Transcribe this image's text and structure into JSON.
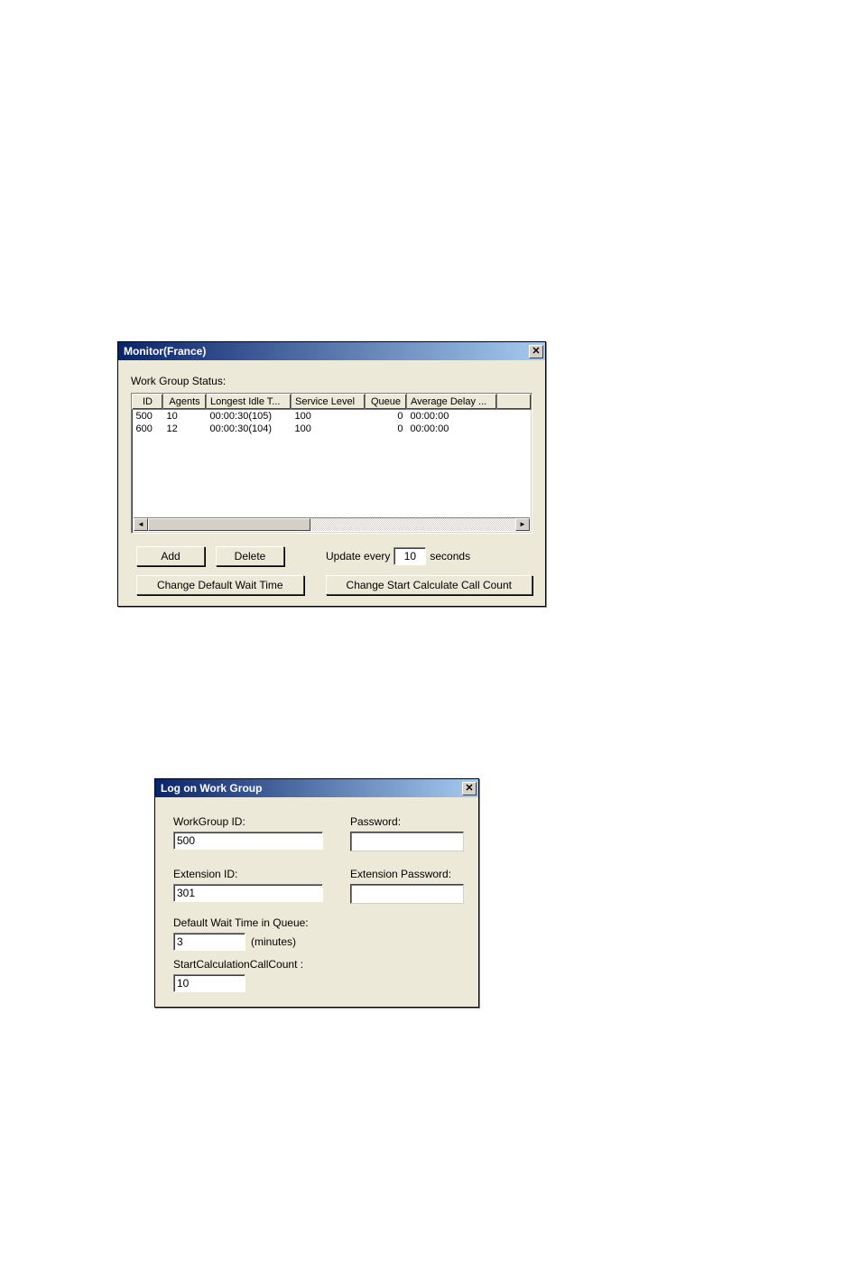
{
  "monitor": {
    "title": "Monitor(France)",
    "status_label": "Work Group Status:",
    "columns": [
      "ID",
      "Agents",
      "Longest Idle T...",
      "Service Level",
      "Queue",
      "Average Delay ..."
    ],
    "rows": [
      {
        "id": "500",
        "agents": "10",
        "lit": "00:00:30(105)",
        "sl": "100",
        "queue": "0",
        "ad": "00:00:00"
      },
      {
        "id": "600",
        "agents": "12",
        "lit": "00:00:30(104)",
        "sl": "100",
        "queue": "0",
        "ad": "00:00:00"
      }
    ],
    "buttons": {
      "add": "Add",
      "delete": "Delete",
      "change_wait": "Change Default Wait Time",
      "change_count": "Change Start Calculate Call Count"
    },
    "update_prefix": "Update every",
    "update_value": "10",
    "update_suffix": "seconds"
  },
  "logon": {
    "title": "Log on Work Group",
    "labels": {
      "workgroup_id": "WorkGroup ID:",
      "password": "Password:",
      "extension_id": "Extension ID:",
      "extension_password": "Extension Password:",
      "default_wait": "Default Wait Time in Queue:",
      "minutes": "(minutes)",
      "start_calc": "StartCalculationCallCount :"
    },
    "values": {
      "workgroup_id": "500",
      "password": "",
      "extension_id": "301",
      "extension_password": "",
      "default_wait": "3",
      "start_calc": "10"
    }
  }
}
